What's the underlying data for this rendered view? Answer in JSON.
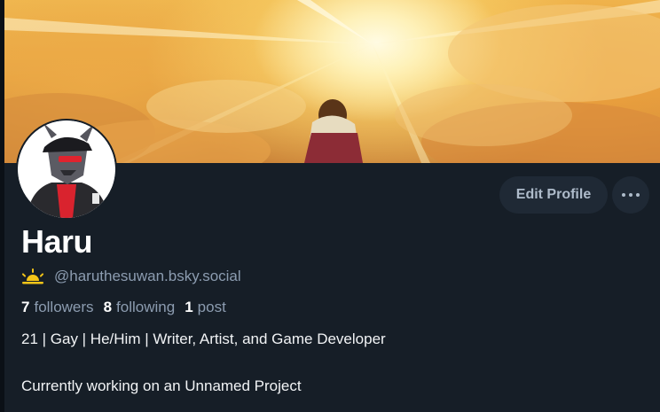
{
  "profile": {
    "display_name": "Haru",
    "handle": "@haruthesuwan.bsky.social",
    "handle_icon": "sunrise-icon",
    "followers_count": "7",
    "followers_label": "followers",
    "following_count": "8",
    "following_label": "following",
    "posts_count": "1",
    "posts_label": "post",
    "bio_line_1": "21 | Gay | He/Him | Writer, Artist, and Game Developer",
    "bio_line_2": "Currently working on an Unnamed Project"
  },
  "actions": {
    "edit_profile_label": "Edit Profile",
    "more_icon": "ellipsis-icon"
  },
  "colors": {
    "background": "#161e27",
    "button_bg": "#1f2935",
    "muted_text": "#8c9cb0",
    "primary_text": "#ffffff"
  }
}
